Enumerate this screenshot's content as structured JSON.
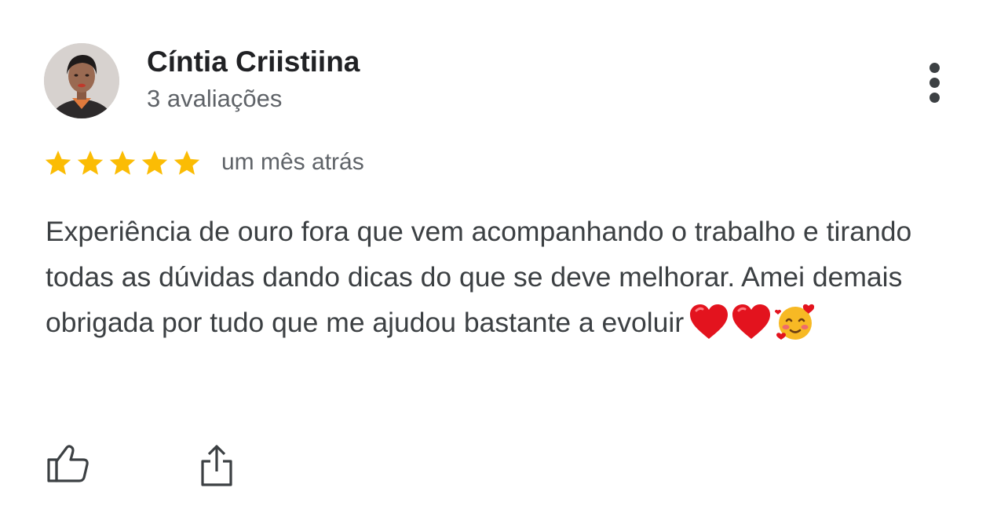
{
  "review": {
    "reviewer_name": "Cíntia Criistiina",
    "review_count": "3 avaliações",
    "rating": 5,
    "rating_max": 5,
    "date": "um mês atrás",
    "text": "Experiência de ouro fora que vem acompanhando o trabalho e tirando todas as dúvidas dando dicas do que se deve melhorar. Amei demais obrigada por tudo que me ajudou bastante a evoluir",
    "emojis": [
      "red-heart",
      "red-heart",
      "smiling-face-with-hearts"
    ]
  },
  "icons": {
    "more": "more-vert-icon",
    "like": "thumbs-up-icon",
    "share": "share-icon",
    "star": "star-icon"
  },
  "colors": {
    "star": "#FBBC04",
    "name_text": "#202124",
    "secondary_text": "#5f6368",
    "body_text": "#3c4043"
  }
}
